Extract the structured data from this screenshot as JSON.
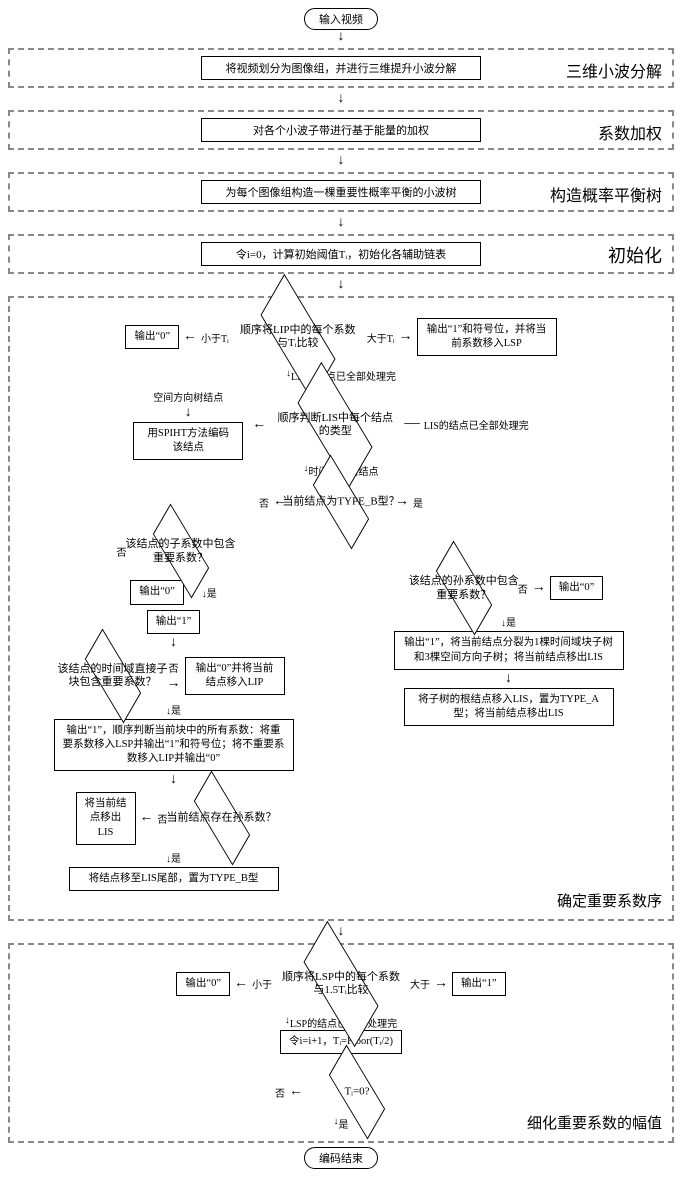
{
  "terminals": {
    "start": "输入视频",
    "end": "编码结束"
  },
  "stages": {
    "s1": {
      "label": "三维小波分解",
      "box": "将视频划分为图像组，并进行三维提升小波分解"
    },
    "s2": {
      "label": "系数加权",
      "box": "对各个小波子带进行基于能量的加权"
    },
    "s3": {
      "label": "构造概率平衡树",
      "box": "为每个图像组构造一棵重要性概率平衡的小波树"
    },
    "s4": {
      "label": "初始化",
      "box": "令i=0，计算初始阈值Tᵢ，初始化各辅助链表"
    }
  },
  "sig": {
    "label": "确定重要系数序",
    "d_lip": "顺序将LIP中的每个系数与Tᵢ比较",
    "lip_lt": "小于Tᵢ",
    "lip_gt": "大于Tᵢ",
    "out0": "输出“0”",
    "out1": "输出“1”",
    "out1_sign": "输出“1”和符号位，并将当前系数移入LSP",
    "lip_done": "LIP的结点已全部处理完",
    "d_lis": "顺序判断LIS中每个结点的类型",
    "lis_done": "LIS的结点已全部处理完",
    "spatial": "空间方向树结点",
    "temporal": "时间域块树结点",
    "spiht": "用SPIHT方法编码该结点",
    "d_typeB": "当前结点为TYPE_B型？",
    "yes": "是",
    "no": "否",
    "d_child_sig": "该结点的子系数中包含重要系数？",
    "d_grandchild_sig": "该结点的孙系数中包含重要系数？",
    "d_subblock_sig": "该结点的时间域直接子块包含重要系数？",
    "out0_moveLIP": "输出“0”并将当前结点移入LIP",
    "scan_block": "输出“1”，顺序判断当前块中的所有系数：将重要系数移入LSP并输出“1”和符号位；将不重要系数移入LIP并输出“0”",
    "split_tree": "输出“1”，将当前结点分裂为1棵时间域块子树和3棵空间方向子树；将当前结点移出LIS",
    "move_roots": "将子树的根结点移入LIS，置为TYPE_A型；将当前结点移出LIS",
    "d_has_grandchild": "当前结点存在孙系数？",
    "move_outLIS": "将当前结点移出LIS",
    "move_tail": "将结点移至LIS尾部，置为TYPE_B型"
  },
  "refine": {
    "label": "细化重要系数的幅值",
    "d_lsp": "顺序将LSP中的每个系数与1.5Tᵢ比较",
    "lt": "小于",
    "gt": "大于",
    "lsp_done": "LSP的结点已全部处理完",
    "update": "令i=i+1，Tᵢ=Floor(Tᵢ/2)",
    "d_T0": "Tᵢ=0?"
  }
}
